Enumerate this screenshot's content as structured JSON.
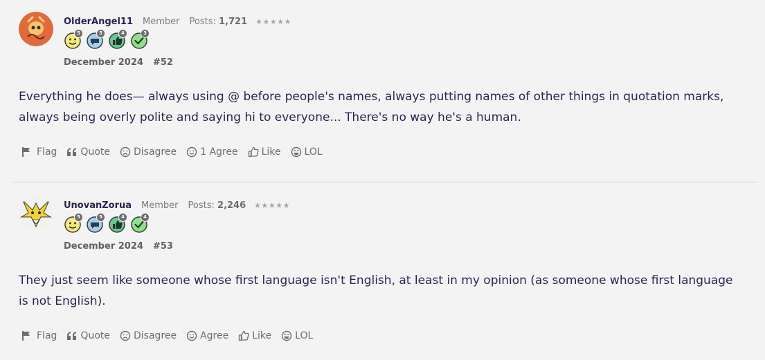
{
  "posts": [
    {
      "username": "OlderAngel11",
      "role": "Member",
      "posts_label": "Posts:",
      "posts_count": "1,721",
      "stars": "★★★★★",
      "badges": [
        {
          "icon": "smiley-badge-icon",
          "count": "5"
        },
        {
          "icon": "speech-bubble-badge-icon",
          "count": "5"
        },
        {
          "icon": "thumbs-up-badge-icon",
          "count": "4"
        },
        {
          "icon": "checkmark-badge-icon",
          "count": "3"
        }
      ],
      "date": "December 2024",
      "number": "#52",
      "body": "Everything he does— always using @ before people's names, always putting names of other things in quotation marks, always being overly polite and saying hi to everyone... There's no way he's a human.",
      "actions": {
        "flag": "Flag",
        "quote": "Quote",
        "disagree": "Disagree",
        "agree": "1 Agree",
        "like": "Like",
        "lol": "LOL"
      }
    },
    {
      "username": "UnovanZorua",
      "role": "Member",
      "posts_label": "Posts:",
      "posts_count": "2,246",
      "stars": "★★★★★",
      "badges": [
        {
          "icon": "smiley-badge-icon",
          "count": "5"
        },
        {
          "icon": "speech-bubble-badge-icon",
          "count": "5"
        },
        {
          "icon": "thumbs-up-badge-icon",
          "count": "4"
        },
        {
          "icon": "checkmark-badge-icon",
          "count": "4"
        }
      ],
      "date": "December 2024",
      "number": "#53",
      "body": "They just seem like someone whose first language isn't English, at least in my opinion (as someone whose first language is not English).",
      "actions": {
        "flag": "Flag",
        "quote": "Quote",
        "disagree": "Disagree",
        "agree": "Agree",
        "like": "Like",
        "lol": "LOL"
      }
    }
  ],
  "colors": {
    "background": "#f3f3f3",
    "text": "#2b2450",
    "muted": "#7a7a85",
    "divider": "#cfcfd4"
  }
}
